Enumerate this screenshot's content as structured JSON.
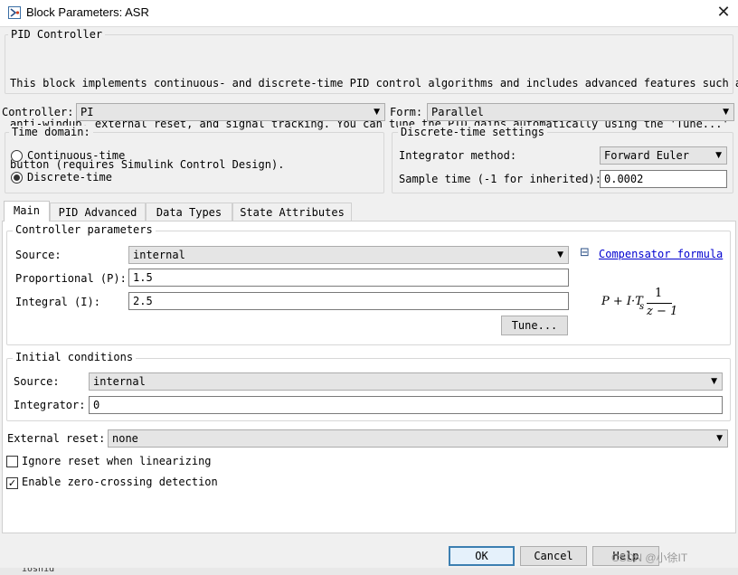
{
  "window": {
    "title": "Block Parameters: ASR",
    "close_icon": "close-icon"
  },
  "header": {
    "block_type": "PID Controller",
    "description_lines": [
      "This block implements continuous- and discrete-time PID control algorithms and includes advanced features such as",
      "anti-windup, external reset, and signal tracking. You can tune the PID gains automatically using the 'Tune...'",
      "button (requires Simulink Control Design)."
    ]
  },
  "controller": {
    "label": "Controller:",
    "value": "PI"
  },
  "form": {
    "label": "Form:",
    "value": "Parallel"
  },
  "time_domain": {
    "legend": "Time domain:",
    "options": [
      {
        "label": "Continuous-time",
        "selected": false
      },
      {
        "label": "Discrete-time",
        "selected": true
      }
    ]
  },
  "discrete_settings": {
    "legend": "Discrete-time settings",
    "integrator_method_label": "Integrator method:",
    "integrator_method_value": "Forward Euler",
    "sample_time_label": "Sample time (-1 for inherited):",
    "sample_time_value": "0.0002"
  },
  "tabs": [
    {
      "label": "Main",
      "active": true
    },
    {
      "label": "PID Advanced",
      "active": false
    },
    {
      "label": "Data Types",
      "active": false
    },
    {
      "label": "State Attributes",
      "active": false
    }
  ],
  "controller_parameters": {
    "legend": "Controller parameters",
    "source_label": "Source:",
    "source_value": "internal",
    "proportional_label": "Proportional (P):",
    "proportional_value": "1.5",
    "integral_label": "Integral (I):",
    "integral_value": "2.5",
    "tune_label": "Tune...",
    "compensator_toggle": "⊟",
    "compensator_link": "Compensator formula",
    "formula": {
      "lhs": "P + I·T",
      "subscript": "s",
      "numerator": "1",
      "denominator": "z − 1"
    }
  },
  "initial_conditions": {
    "legend": "Initial conditions",
    "source_label": "Source:",
    "source_value": "internal",
    "integrator_label": "Integrator:",
    "integrator_value": "0"
  },
  "external_reset": {
    "label": "External reset:",
    "value": "none"
  },
  "checkboxes": [
    {
      "label": "Ignore reset when linearizing",
      "checked": false
    },
    {
      "label": "Enable zero-crossing detection",
      "checked": true
    }
  ],
  "buttons": {
    "ok": "OK",
    "cancel": "Cancel",
    "help": "Help"
  },
  "watermark": "CSDN @小徐IT",
  "background_snippet": "iosnid"
}
